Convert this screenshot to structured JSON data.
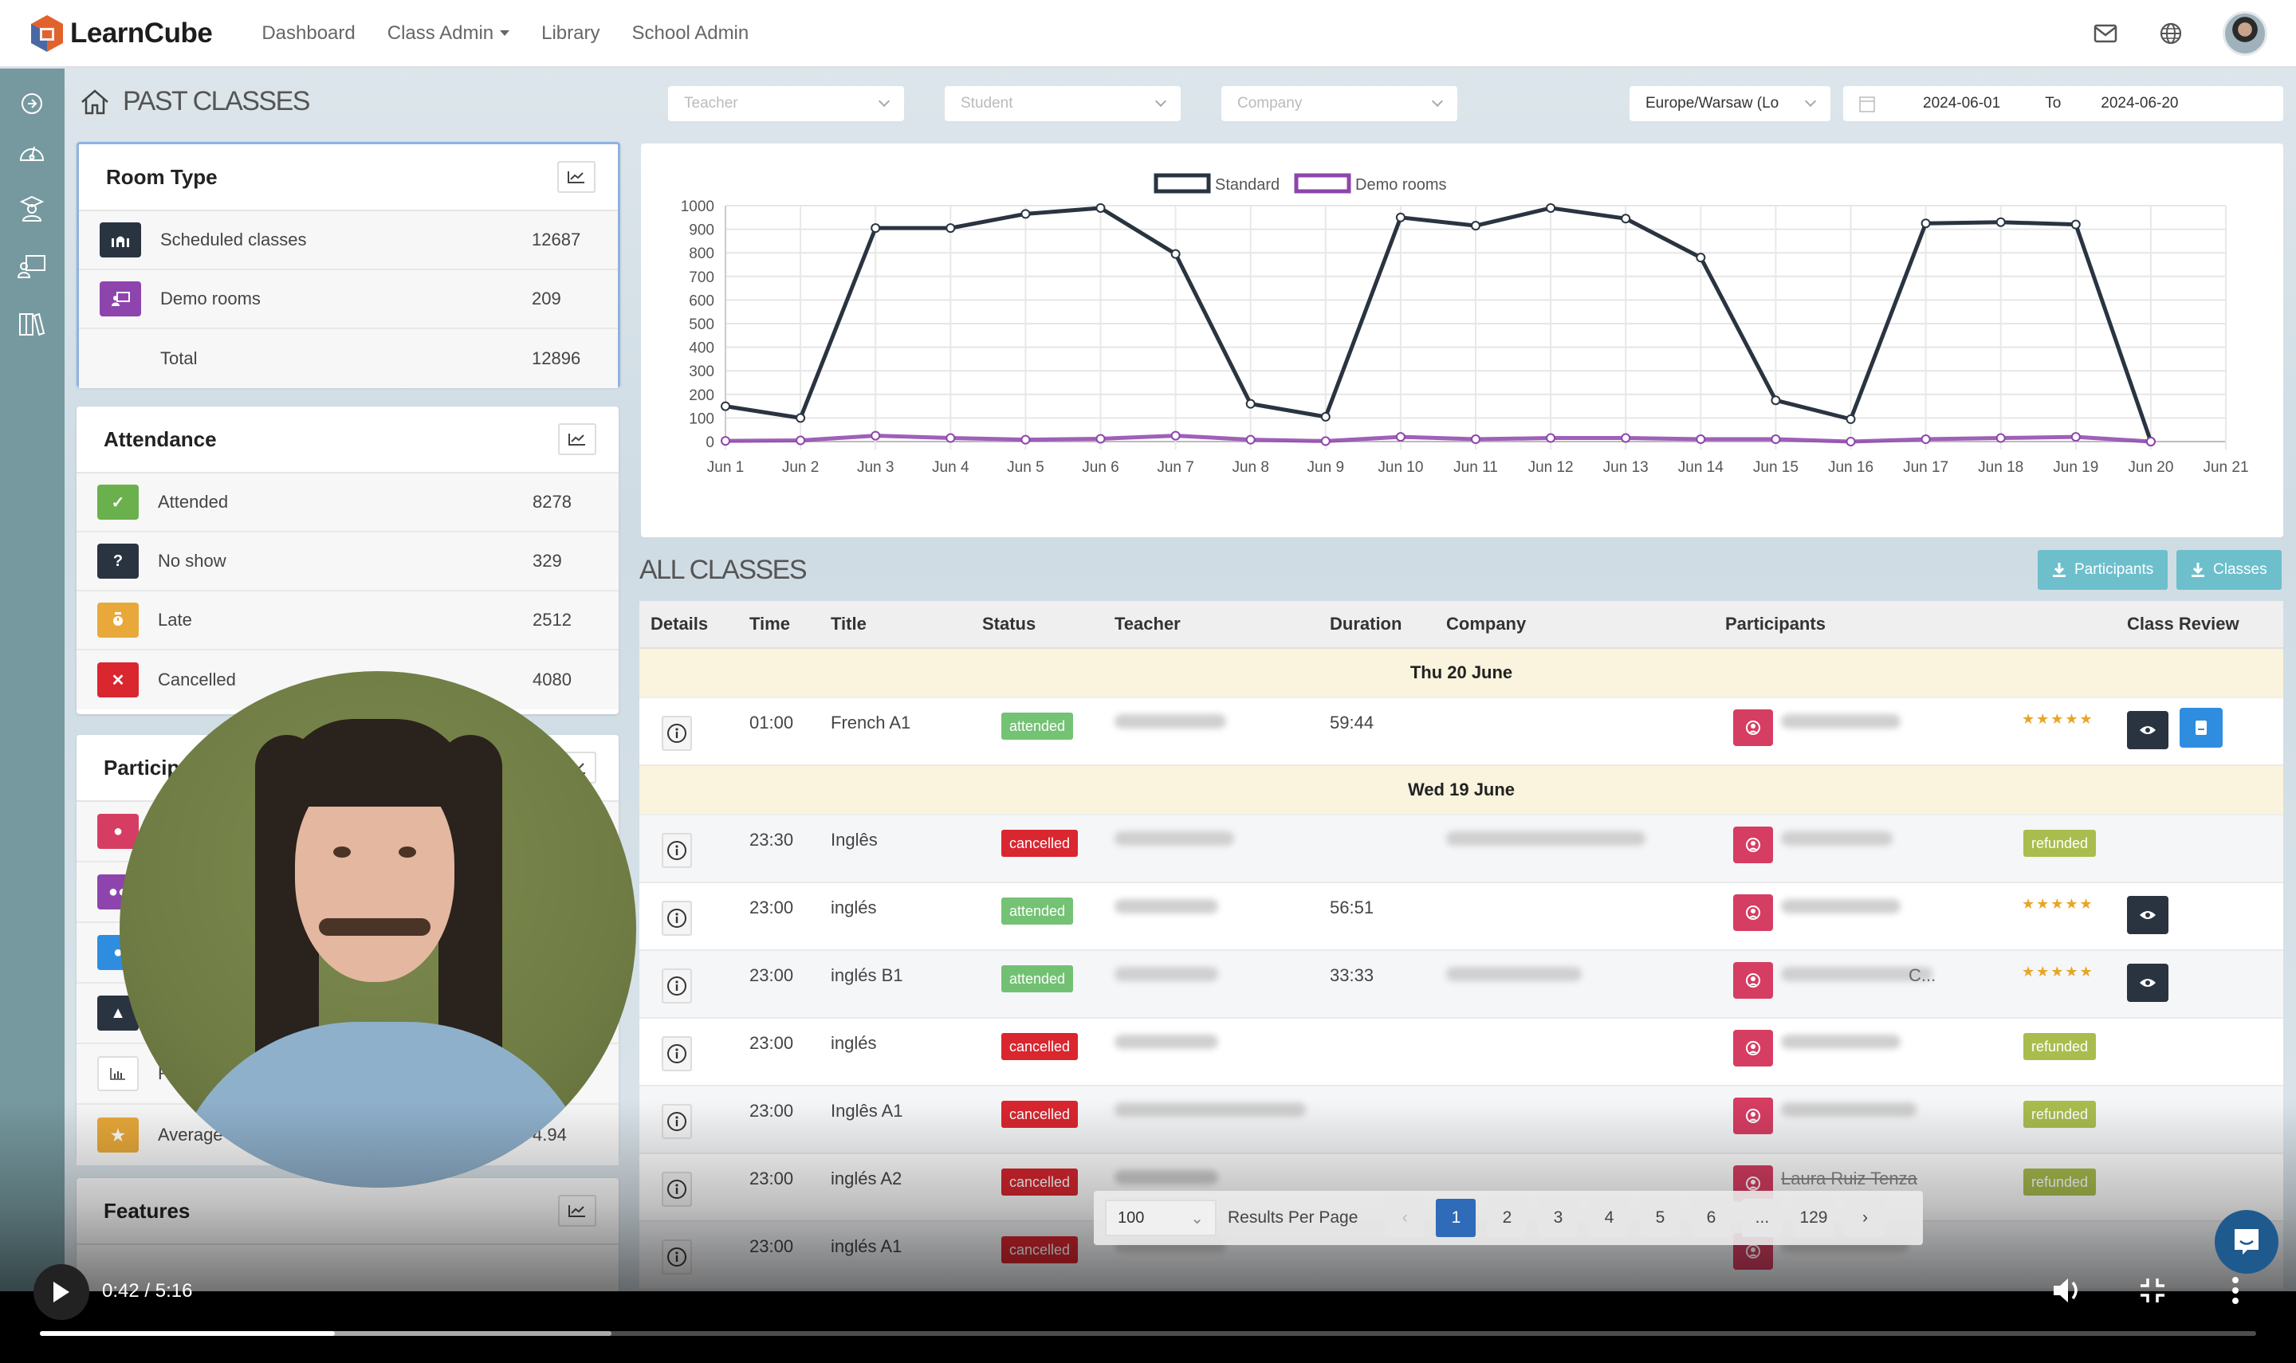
{
  "nav": {
    "brand": "LearnCube",
    "links": [
      "Dashboard",
      "Class Admin",
      "Library",
      "School Admin"
    ],
    "icons": [
      "mail-icon",
      "globe-icon",
      "user-avatar"
    ]
  },
  "sidebar": {
    "items": [
      "arrow-right-circle-icon",
      "dashboard-gauge-icon",
      "student-icon",
      "teacher-classroom-icon",
      "library-books-icon"
    ]
  },
  "page": {
    "title": "PAST CLASSES",
    "filters": {
      "teacher_placeholder": "Teacher",
      "student_placeholder": "Student",
      "company_placeholder": "Company",
      "timezone": "Europe/Warsaw (Lo",
      "date_from": "2024-06-01",
      "date_to_label": "To",
      "date_to": "2024-06-20"
    }
  },
  "room_type": {
    "title": "Room Type",
    "rows": [
      {
        "label": "Scheduled classes",
        "value": "12687",
        "color": "#2a3441",
        "icon": "classroom-icon"
      },
      {
        "label": "Demo rooms",
        "value": "209",
        "color": "#8e44ad",
        "icon": "presentation-icon"
      },
      {
        "label": "Total",
        "value": "12896"
      }
    ]
  },
  "attendance": {
    "title": "Attendance",
    "rows": [
      {
        "label": "Attended",
        "value": "8278",
        "color": "#6ab04c",
        "icon": "check-icon"
      },
      {
        "label": "No show",
        "value": "329",
        "color": "#2a3441",
        "icon": "question-icon"
      },
      {
        "label": "Late",
        "value": "2512",
        "color": "#e8a93a",
        "icon": "stopwatch-icon"
      },
      {
        "label": "Cancelled",
        "value": "4080",
        "color": "#d9262f",
        "icon": "x-icon"
      }
    ]
  },
  "participants": {
    "title": "Particip",
    "rows": [
      {
        "color": "#d63d62",
        "icon": "user-icon"
      },
      {
        "color": "#8e44ad",
        "icon": "users-icon"
      },
      {
        "color": "#2f8de0",
        "icon": "user-icon"
      },
      {
        "color": "#2a3441",
        "icon": "graduate-icon"
      },
      {
        "color": "#ffffff",
        "icon": "bar-chart-icon",
        "label": "R"
      },
      {
        "color": "#e8a93a",
        "icon": "star-icon",
        "label": "Average",
        "value": "4.94"
      }
    ]
  },
  "features": {
    "title": "Features"
  },
  "chart_data": {
    "type": "line",
    "title": "",
    "legend": [
      "Standard",
      "Demo rooms"
    ],
    "legend_position": "top-center",
    "x": [
      "Jun 1",
      "Jun 2",
      "Jun 3",
      "Jun 4",
      "Jun 5",
      "Jun 6",
      "Jun 7",
      "Jun 8",
      "Jun 9",
      "Jun 10",
      "Jun 11",
      "Jun 12",
      "Jun 13",
      "Jun 14",
      "Jun 15",
      "Jun 16",
      "Jun 17",
      "Jun 18",
      "Jun 19",
      "Jun 20",
      "Jun 21"
    ],
    "series": [
      {
        "name": "Standard",
        "color": "#2a3441",
        "values": [
          150,
          100,
          905,
          905,
          965,
          990,
          795,
          160,
          105,
          950,
          915,
          990,
          945,
          780,
          175,
          95,
          925,
          930,
          920,
          0
        ]
      },
      {
        "name": "Demo rooms",
        "color": "#8e44ad",
        "values": [
          3,
          5,
          25,
          15,
          8,
          12,
          25,
          8,
          2,
          20,
          10,
          15,
          15,
          10,
          10,
          0,
          10,
          15,
          20,
          0
        ]
      }
    ],
    "yticks": [
      0,
      100,
      200,
      300,
      400,
      500,
      600,
      700,
      800,
      900,
      1000
    ],
    "ylim": [
      0,
      1000
    ],
    "grid": true,
    "xlabel": "",
    "ylabel": ""
  },
  "classes": {
    "title": "ALL CLASSES",
    "buttons": {
      "participants": "Participants",
      "classes": "Classes"
    },
    "columns": [
      "Details",
      "Time",
      "Title",
      "Status",
      "Teacher",
      "Duration",
      "Company",
      "Participants",
      "Class Review"
    ],
    "groups": [
      {
        "date": "Thu 20 June",
        "rows": [
          {
            "time": "01:00",
            "title": "French A1",
            "status": "attended",
            "duration": "59:44",
            "review": "stars",
            "rating": "★★★★★",
            "has_view": true,
            "has_report": true
          }
        ]
      },
      {
        "date": "Wed 19 June",
        "rows": [
          {
            "time": "23:30",
            "title": "Inglês",
            "status": "cancelled",
            "duration": "",
            "review": "refunded",
            "has_company": true
          },
          {
            "time": "23:00",
            "title": "inglés",
            "status": "attended",
            "duration": "56:51",
            "review": "stars",
            "rating": "★★★★★",
            "has_view": true
          },
          {
            "time": "23:00",
            "title": "inglés B1",
            "status": "attended",
            "duration": "33:33",
            "review": "stars",
            "rating": "★★★★★",
            "has_view": true,
            "has_company": true,
            "participant_suffix": "C..."
          },
          {
            "time": "23:00",
            "title": "inglés",
            "status": "cancelled",
            "duration": "",
            "review": "refunded"
          },
          {
            "time": "23:00",
            "title": "Inglês A1",
            "status": "cancelled",
            "duration": "",
            "review": "refunded"
          },
          {
            "time": "23:00",
            "title": "inglés A2",
            "status": "cancelled",
            "duration": "",
            "review": "refunded",
            "participant": "Laura Ruiz Tenza"
          },
          {
            "time": "23:00",
            "title": "inglés A1",
            "status": "cancelled",
            "duration": "",
            "review": ""
          }
        ]
      }
    ],
    "pagination": {
      "per_page": "100",
      "per_page_label": "Results Per Page",
      "pages": [
        "1",
        "2",
        "3",
        "4",
        "5",
        "6",
        "...",
        "129"
      ],
      "current": "1"
    }
  },
  "video": {
    "time": "0:42 / 5:16",
    "played_fraction": 0.133,
    "buffered_fraction": 0.258
  }
}
